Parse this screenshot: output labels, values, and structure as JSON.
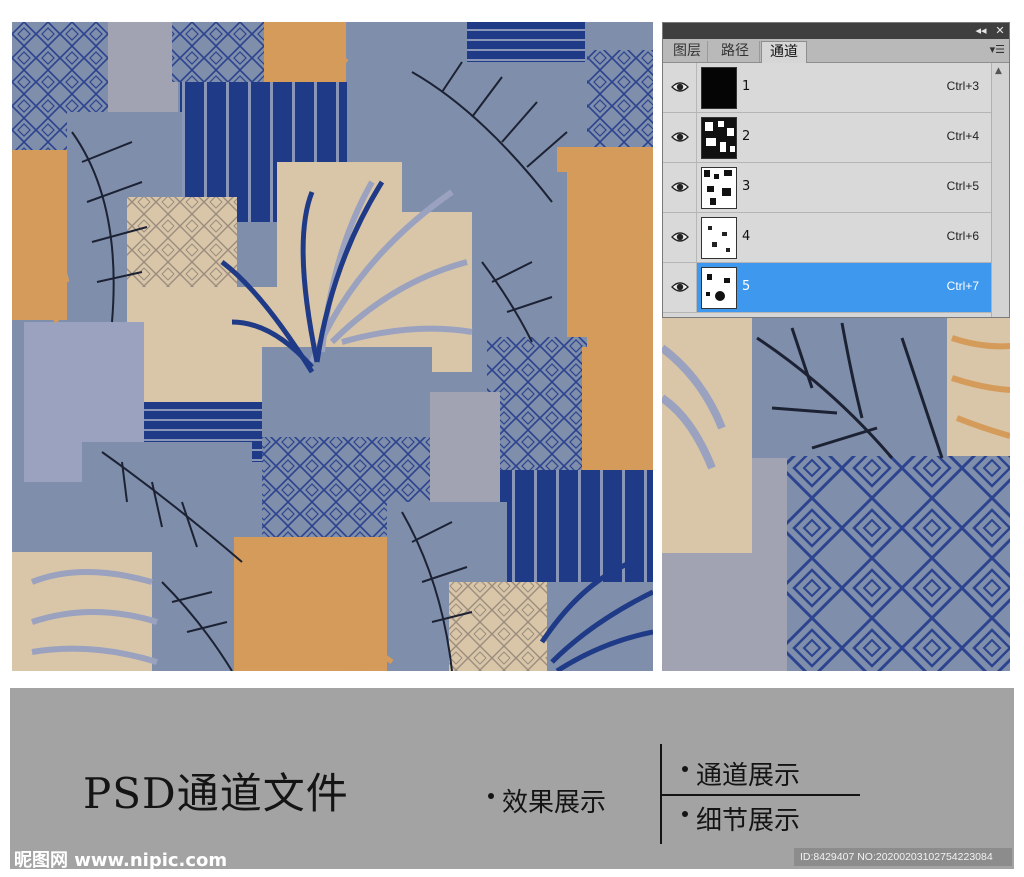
{
  "panel": {
    "collapse_glyph": "◂◂",
    "close_glyph": "✕",
    "tabs": [
      {
        "label": "图层",
        "active": false
      },
      {
        "label": "路径",
        "active": false
      },
      {
        "label": "通道",
        "active": true
      }
    ],
    "channels": [
      {
        "name": "1",
        "shortcut": "Ctrl+3",
        "selected": false,
        "visible": true,
        "icon": "eye-icon"
      },
      {
        "name": "2",
        "shortcut": "Ctrl+4",
        "selected": false,
        "visible": true,
        "icon": "eye-icon"
      },
      {
        "name": "3",
        "shortcut": "Ctrl+5",
        "selected": false,
        "visible": true,
        "icon": "eye-icon"
      },
      {
        "name": "4",
        "shortcut": "Ctrl+6",
        "selected": false,
        "visible": true,
        "icon": "eye-icon"
      },
      {
        "name": "5",
        "shortcut": "Ctrl+7",
        "selected": true,
        "visible": true,
        "icon": "eye-icon"
      }
    ],
    "accent_color": "#3d98ee"
  },
  "caption": {
    "title": "PSD通道文件",
    "effect": "效果展示",
    "channel_show": "通道展示",
    "detail_show": "细节展示"
  },
  "watermark": {
    "logo": "昵图网 www.nipic.com",
    "id": "ID:8429407 NO:20200203102754223084"
  },
  "palette": {
    "navy": "#1f3a86",
    "slate": "#7f8eab",
    "tan": "#d9c6a8",
    "orange": "#d49b5a",
    "grey": "#a2a3b2"
  }
}
